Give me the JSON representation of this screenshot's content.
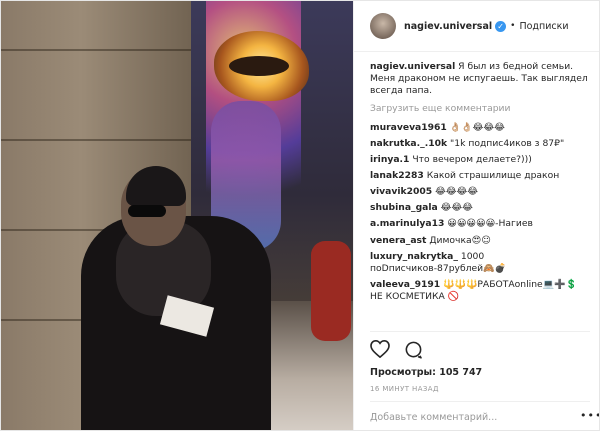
{
  "header": {
    "username": "nagiev.universal",
    "verified_icon": "verified-badge-icon",
    "separator": "•",
    "follow_label": "Подписки"
  },
  "caption": {
    "username": "nagiev.universal",
    "text": "Я был из бедной семьи. Меня драконом не испугаешь. Так выглядел всегда папа."
  },
  "load_more_label": "Загрузить еще комментарии",
  "comments": [
    {
      "username": "muraveva1961",
      "text": "👌🏼👌🏼😂😂😂"
    },
    {
      "username": "nakrutka._.10k",
      "text": "\"1k подпис4иков з 87₽\""
    },
    {
      "username": "irinya.1",
      "text": "Что вечером делаете?)))"
    },
    {
      "username": "lanak2283",
      "text": "Какой страшилище дракон"
    },
    {
      "username": "vivavik2005",
      "text": "😂😂😂😂"
    },
    {
      "username": "shubina_gala",
      "text": "😂😂😂"
    },
    {
      "username": "a.marinulya13",
      "text": "😀😀😀😀😀-Нагиев"
    },
    {
      "username": "venera_ast",
      "text": "Димочка😍☺"
    },
    {
      "username": "luxury_nakrytka_",
      "text": "1000 поDписчиков-87рублей🙈💣"
    },
    {
      "username": "valeeva_9191",
      "text": "🔱🔱🔱РАБОТАonline💻➕💲 НЕ КОСМЕТИКА 🚫"
    }
  ],
  "actions": {
    "like_icon": "heart-icon",
    "comment_icon": "comment-icon"
  },
  "views_label": "Просмотры: 105 747",
  "time_label": "16 МИНУТ НАЗАД",
  "add_comment_placeholder": "Добавьте комментарий...",
  "more_label": "•••"
}
